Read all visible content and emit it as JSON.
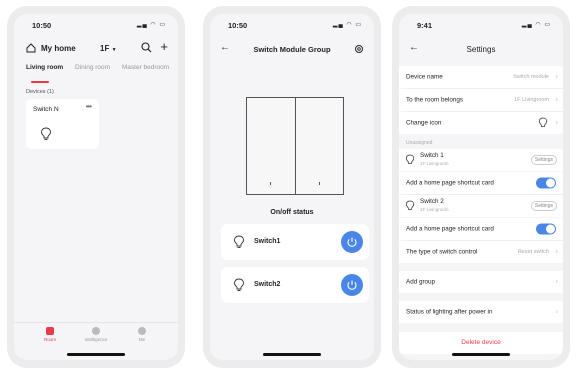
{
  "colors": {
    "accent_red": "#e83a4a",
    "accent_blue": "#4a86e8"
  },
  "phone1": {
    "time": "10:50",
    "home_icon": "home-icon",
    "title": "My home",
    "floor": "1F",
    "tabs": [
      "Living room",
      "Dining room",
      "Master bedroom"
    ],
    "active_tab": 0,
    "devices_label": "Devices (1)",
    "device": {
      "name": "Switch N",
      "icon": "bulb-icon"
    },
    "nav": [
      {
        "label": "Room",
        "active": true
      },
      {
        "label": "Intelligence",
        "active": false
      },
      {
        "label": "Me",
        "active": false
      }
    ]
  },
  "phone2": {
    "time": "10:50",
    "title": "Switch Module Group",
    "status_label": "On/off status",
    "switches": [
      {
        "label": "Switch1",
        "on": true
      },
      {
        "label": "Switch2",
        "on": true
      }
    ]
  },
  "phone3": {
    "time": "9:41",
    "title": "Settings",
    "device_name_label": "Device name",
    "device_name_value": "Switch module",
    "room_label": "To the room belongs",
    "room_value": "1F Livingroom",
    "change_icon_label": "Change icon",
    "section_label": "Unassigned",
    "switches": [
      {
        "name": "Switch 1",
        "room": "1F Livingroom",
        "settings_label": "Settings",
        "shortcut_label": "Add a home page shortcut card",
        "shortcut_on": true
      },
      {
        "name": "Switch 2",
        "room": "1F Livingroom",
        "settings_label": "Settings",
        "shortcut_label": "Add a home page shortcut card",
        "shortcut_on": true
      }
    ],
    "switch_type_label": "The type of switch control",
    "switch_type_value": "Reset switch",
    "add_group_label": "Add group",
    "lighting_status_label": "Status of lighting after power in",
    "delete_label": "Delete device"
  }
}
